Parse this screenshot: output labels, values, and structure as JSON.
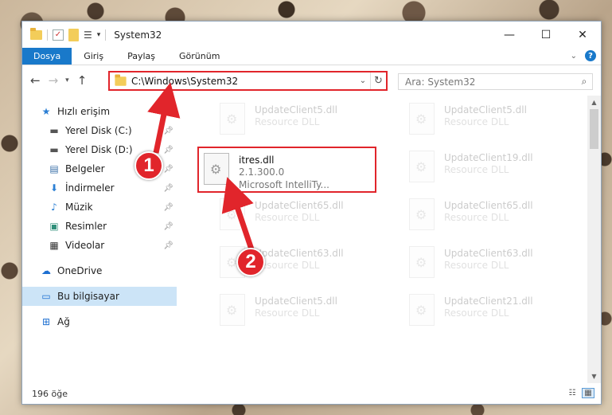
{
  "window": {
    "title": "System32",
    "controls": {
      "minimize": "—",
      "maximize": "☐",
      "close": "✕"
    }
  },
  "ribbon": {
    "tabs": [
      {
        "label": "Dosya",
        "active": true
      },
      {
        "label": "Giriş"
      },
      {
        "label": "Paylaş"
      },
      {
        "label": "Görünüm"
      }
    ],
    "help": "?"
  },
  "navigation": {
    "address": "C:\\Windows\\System32",
    "search_placeholder": "Ara: System32"
  },
  "sidebar": {
    "quick_access": "Hızlı erişim",
    "items": [
      {
        "label": "Yerel Disk (C:)",
        "icon": "drive-icon",
        "pinned": true
      },
      {
        "label": "Yerel Disk (D:)",
        "icon": "drive-icon",
        "pinned": true
      },
      {
        "label": "Belgeler",
        "icon": "documents-icon",
        "pinned": true
      },
      {
        "label": "İndirmeler",
        "icon": "downloads-icon",
        "pinned": true
      },
      {
        "label": "Müzik",
        "icon": "music-icon",
        "pinned": true
      },
      {
        "label": "Resimler",
        "icon": "pictures-icon",
        "pinned": true
      },
      {
        "label": "Videolar",
        "icon": "videos-icon",
        "pinned": true
      }
    ],
    "onedrive": "OneDrive",
    "this_pc": "Bu bilgisayar",
    "network": "Ağ"
  },
  "files": {
    "left": [
      {
        "name": "UpdateClient5.dll",
        "type": "Resource DLL",
        "faded": true
      },
      {
        "name": "itres.dll",
        "version": "2.1.300.0",
        "description": "Microsoft IntelliTy...",
        "faded": false,
        "highlighted": true
      },
      {
        "name": "UpdateClient65.dll",
        "type": "Resource DLL",
        "faded": true
      },
      {
        "name": "UpdateClient63.dll",
        "type": "Resource DLL",
        "faded": true
      },
      {
        "name": "UpdateClient5.dll",
        "type": "Resource DLL",
        "faded": true
      }
    ],
    "right": [
      {
        "name": "UpdateClient5.dll",
        "type": "Resource DLL",
        "faded": true
      },
      {
        "name": "UpdateClient19.dll",
        "type": "Resource DLL",
        "faded": true
      },
      {
        "name": "UpdateClient65.dll",
        "type": "Resource DLL",
        "faded": true
      },
      {
        "name": "UpdateClient63.dll",
        "type": "Resource DLL",
        "faded": true
      },
      {
        "name": "UpdateClient21.dll",
        "type": "Resource DLL",
        "faded": true
      }
    ]
  },
  "status": {
    "item_count": "196 öğe"
  },
  "annotations": {
    "step1": "1",
    "step2": "2",
    "color": "#e1252b"
  }
}
